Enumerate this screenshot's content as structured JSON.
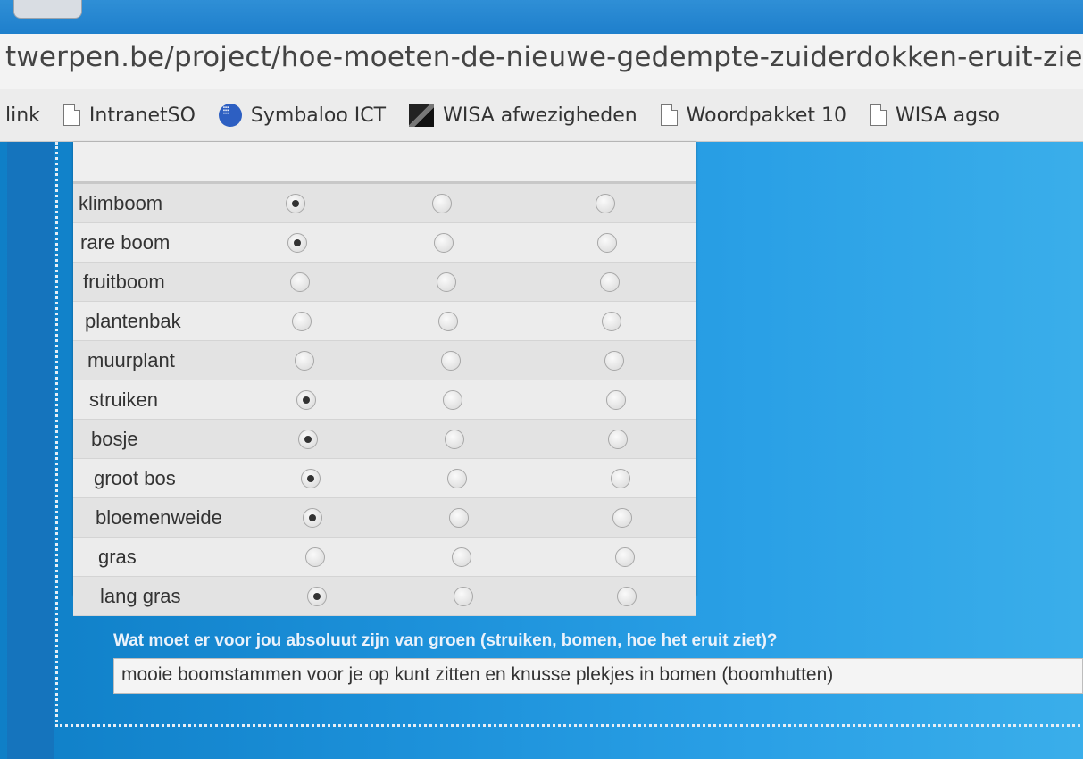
{
  "browser": {
    "url_visible": "twerpen.be/project/hoe-moeten-de-nieuwe-gedempte-zuiderdokken-eruit-zien",
    "bookmarks": [
      {
        "label": "link",
        "icon": "none"
      },
      {
        "label": "IntranetSO",
        "icon": "file-icon"
      },
      {
        "label": "Symbaloo ICT",
        "icon": "symbaloo-icon"
      },
      {
        "label": "WISA afwezigheden",
        "icon": "wisa-icon"
      },
      {
        "label": "Woordpakket 10",
        "icon": "file-icon"
      },
      {
        "label": "WISA agso",
        "icon": "file-icon"
      }
    ]
  },
  "survey": {
    "rows": [
      {
        "label": "klimboom",
        "selected": 1
      },
      {
        "label": "rare boom",
        "selected": 1
      },
      {
        "label": "fruitboom",
        "selected": 0
      },
      {
        "label": "plantenbak",
        "selected": 0
      },
      {
        "label": "muurplant",
        "selected": 0
      },
      {
        "label": "struiken",
        "selected": 1
      },
      {
        "label": "bosje",
        "selected": 1
      },
      {
        "label": "groot bos",
        "selected": 1
      },
      {
        "label": "bloemenweide",
        "selected": 1
      },
      {
        "label": "gras",
        "selected": 0
      },
      {
        "label": "lang gras",
        "selected": 1
      }
    ],
    "question": "Wat moet er voor jou absoluut zijn van groen (struiken, bomen, hoe het eruit ziet)?",
    "answer": "mooie boomstammen voor je op kunt zitten en knusse plekjes in bomen (boomhutten)"
  },
  "colors": {
    "page_blue": "#1d8fd8",
    "panel_gray": "#e9e9e9"
  }
}
